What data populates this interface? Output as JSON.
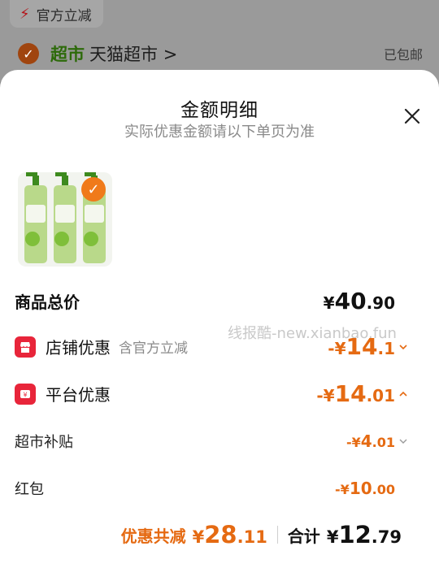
{
  "background": {
    "badge_label": "官方立减",
    "store_tag": "超市",
    "store_name": "天猫超市",
    "store_chevron": ">",
    "shipping": "已包邮"
  },
  "sheet": {
    "title": "金额明细",
    "subtitle": "实际优惠金额请以下单页为准"
  },
  "product": {
    "selected": true
  },
  "rows": {
    "total_price": {
      "label": "商品总价",
      "prefix": "¥",
      "int": "40",
      "dec": ".90"
    },
    "store_discount": {
      "label": "店铺优惠",
      "note": "含官方立减",
      "prefix": "-¥",
      "int": "14",
      "dec": ".1"
    },
    "platform_discount": {
      "label": "平台优惠",
      "prefix": "-¥",
      "int": "14",
      "dec": ".01"
    },
    "supermarket_subsidy": {
      "label": "超市补贴",
      "prefix": "-¥",
      "int": "4",
      "dec": ".01"
    },
    "red_packet": {
      "label": "红包",
      "prefix": "-¥",
      "int": "10",
      "dec": ".00"
    }
  },
  "footer": {
    "savings_label": "优惠共减",
    "savings_prefix": "¥",
    "savings_int": "28",
    "savings_dec": ".11",
    "total_label": "合计",
    "total_prefix": "¥",
    "total_int": "12",
    "total_dec": ".79"
  },
  "watermark": "线报酷-new.xianbao.fun",
  "colors": {
    "accent": "#e56a12",
    "badge_red": "#e8253a",
    "check_orange": "#f07a1a"
  }
}
